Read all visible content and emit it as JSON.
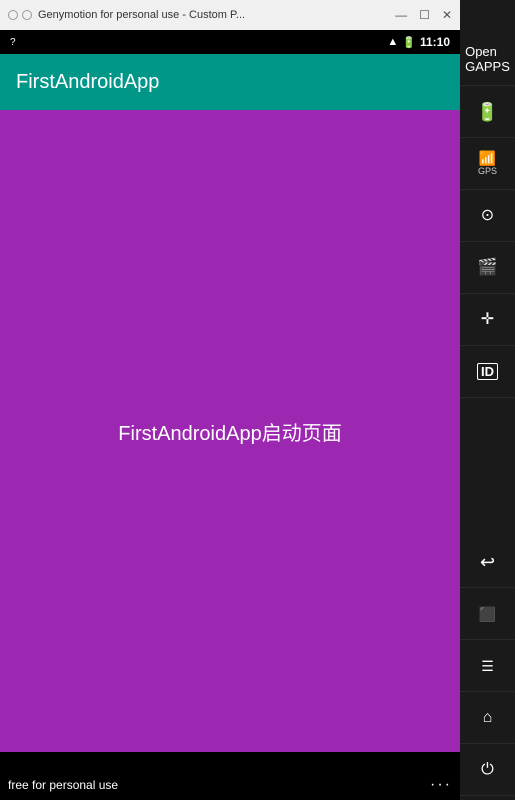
{
  "titleBar": {
    "title": "Genymotion for personal use - Custom P...",
    "minBtn": "—",
    "maxBtn": "☐",
    "closeBtn": "✕"
  },
  "statusBar": {
    "questionMark": "?",
    "time": "11:10"
  },
  "appBar": {
    "title": "FirstAndroidApp"
  },
  "mainContent": {
    "text": "FirstAndroidApp启动页面"
  },
  "sidebar": {
    "items": [
      {
        "id": "open-gapps",
        "icon": "⊞",
        "label": "Open\nGAPPS"
      },
      {
        "id": "battery",
        "icon": "🔋",
        "label": ""
      },
      {
        "id": "gps",
        "icon": "📡",
        "label": "GPS"
      },
      {
        "id": "camera",
        "icon": "⊙",
        "label": ""
      },
      {
        "id": "video",
        "icon": "🎬",
        "label": ""
      },
      {
        "id": "move",
        "icon": "⊕",
        "label": ""
      },
      {
        "id": "device-id",
        "icon": "ID",
        "label": ""
      },
      {
        "id": "back-nav",
        "icon": "↩",
        "label": ""
      },
      {
        "id": "recent",
        "icon": "⬛",
        "label": ""
      },
      {
        "id": "menu",
        "icon": "☰",
        "label": ""
      },
      {
        "id": "home",
        "icon": "⌂",
        "label": ""
      },
      {
        "id": "power",
        "icon": "⏻",
        "label": ""
      }
    ]
  },
  "navBar": {
    "backBtn": "◁",
    "homeBtn": "○",
    "recentBtn": "□"
  },
  "watermark": {
    "text": "free for personal use",
    "more": "···"
  }
}
